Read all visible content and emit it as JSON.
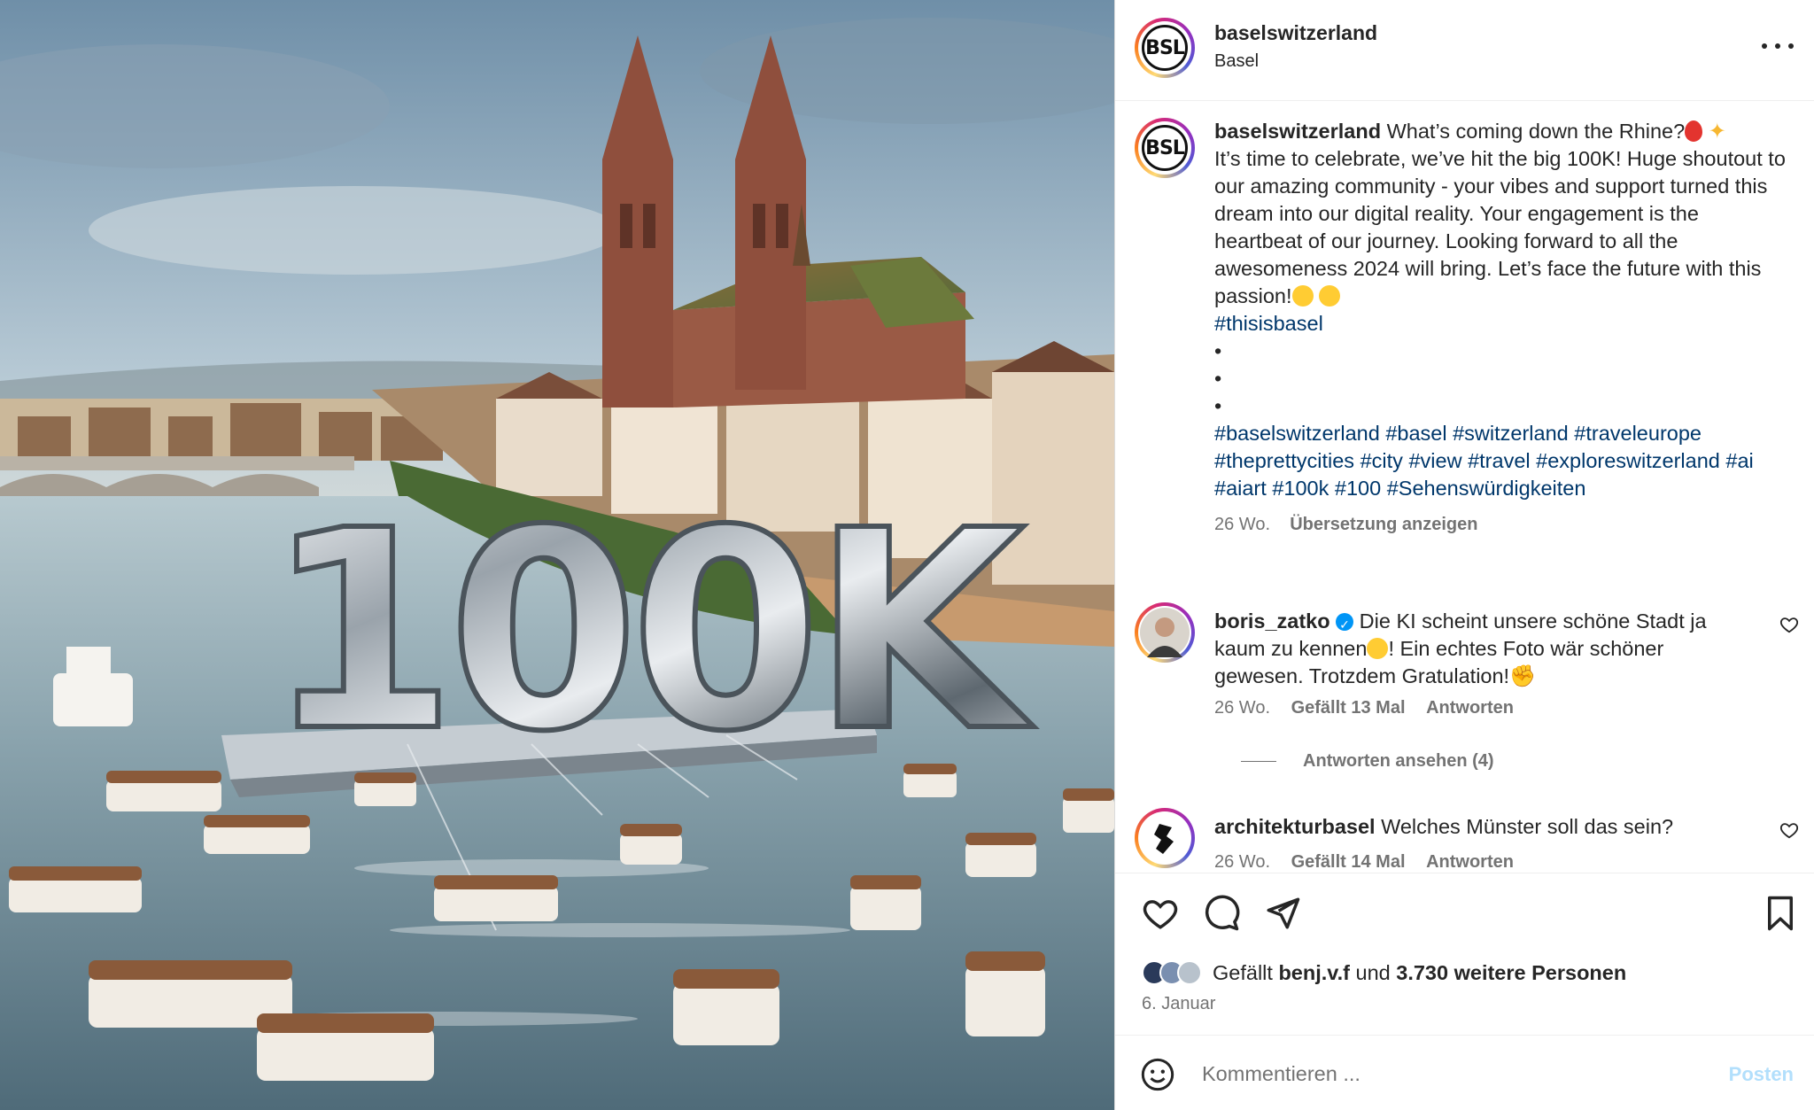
{
  "post": {
    "username": "baselswitzerland",
    "location": "Basel",
    "avatar_text": "BSL",
    "image_text": "100K"
  },
  "caption": {
    "username": "baselswitzerland",
    "text_1": "What’s coming down the Rhine?",
    "text_2": "It’s time to celebrate, we’ve hit the big 100K! Huge shoutout to our amazing community - your vibes and support turned this dream into our digital reality. Your engagement is the heartbeat of our journey. Looking forward to all the awesomeness 2024 will bring. Let’s face the future with this passion!",
    "hashtag_1": "#thisisbasel",
    "dots": [
      "•",
      "•",
      "•"
    ],
    "hashtags": [
      "#baselswitzerland",
      "#basel",
      "#switzerland",
      "#traveleurope",
      "#theprettycities",
      "#city",
      "#view",
      "#travel",
      "#exploreswitzerland",
      "#ai",
      "#aiart",
      "#100k",
      "#100",
      "#Sehenswürdigkeiten"
    ],
    "age": "26 Wo.",
    "translate": "Übersetzung anzeigen"
  },
  "comments": [
    {
      "username": "boris_zatko",
      "text_1": "Die KI scheint unsere schöne Stadt ja kaum zu kennen",
      "text_2": "! Ein echtes Foto wär schöner gewesen. Trotzdem Gratulation!",
      "age": "26 Wo.",
      "likes": "Gefällt 13 Mal",
      "reply": "Antworten",
      "view_replies": "Antworten ansehen (4)"
    },
    {
      "username": "architekturbasel",
      "text_1": "Welches Münster soll das sein?",
      "age": "26 Wo.",
      "likes": "Gefällt 14 Mal",
      "reply": "Antworten"
    }
  ],
  "likes": {
    "prefix": "Gefällt",
    "user": "benj.v.f",
    "connector": "und",
    "others": "3.730 weitere Personen"
  },
  "date": "6. Januar",
  "comment_box": {
    "placeholder": "Kommentieren ...",
    "post_label": "Posten"
  },
  "icons": [
    "more-icon",
    "heart-icon",
    "comment-icon",
    "share-icon",
    "bookmark-icon",
    "emoji-icon"
  ],
  "colors": {
    "hashtag": "#00376b",
    "meta": "#737373",
    "post_disabled": "#b2dffc",
    "verified": "#0095f6"
  }
}
